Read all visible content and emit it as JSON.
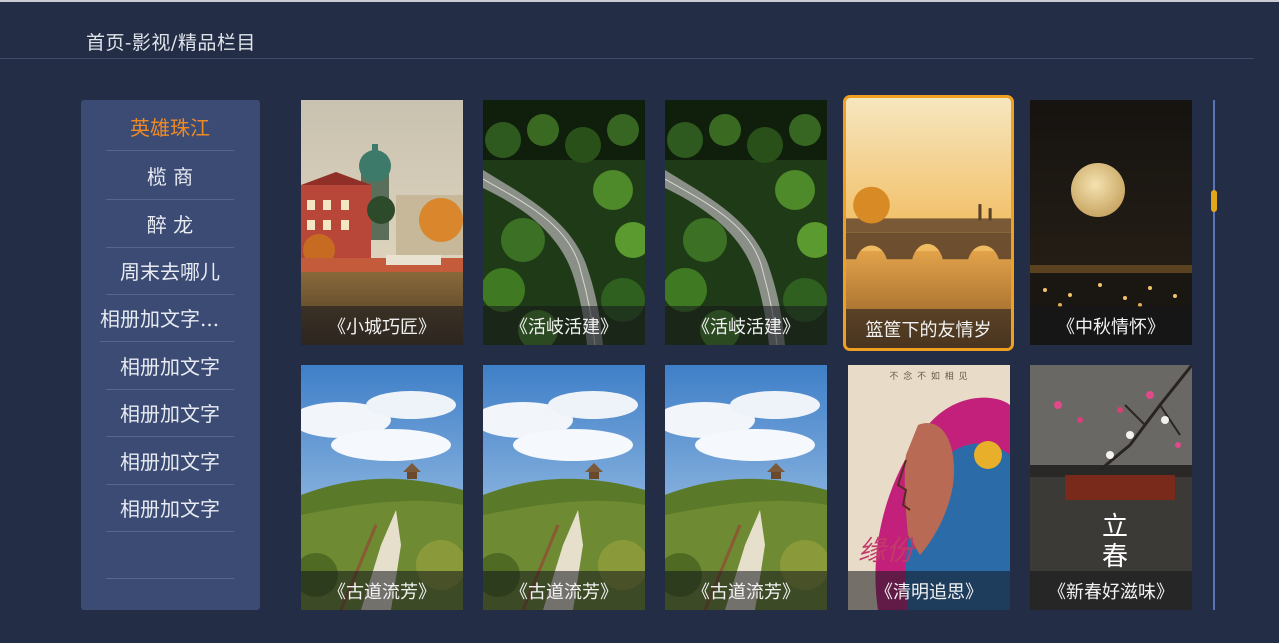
{
  "breadcrumb": "首页-影视/精品栏目",
  "sidebar": {
    "items": [
      {
        "label": "英雄珠江",
        "active": true
      },
      {
        "label": "榄 商"
      },
      {
        "label": "醉 龙"
      },
      {
        "label": "周末去哪儿"
      },
      {
        "label": "相册加文字..."
      },
      {
        "label": "相册加文字"
      },
      {
        "label": "相册加文字"
      },
      {
        "label": "相册加文字"
      },
      {
        "label": "相册加文字"
      }
    ]
  },
  "grid": {
    "cards": [
      {
        "title": "《小城巧匠》",
        "scene": "town"
      },
      {
        "title": "《活岐活建》",
        "scene": "forest-road"
      },
      {
        "title": "《活岐活建》",
        "scene": "forest-road"
      },
      {
        "title": "篮筐下的友情岁",
        "scene": "bridge",
        "focused": true
      },
      {
        "title": "《中秋情怀》",
        "scene": "moon"
      },
      {
        "title": "《古道流芳》",
        "scene": "trail"
      },
      {
        "title": "《古道流芳》",
        "scene": "trail"
      },
      {
        "title": "《古道流芳》",
        "scene": "trail"
      },
      {
        "title": "《清明追思》",
        "scene": "poster",
        "poster_top": "不 念 不 如 相 见",
        "poster_big": "缘份"
      },
      {
        "title": "《新春好滋味》",
        "scene": "spring",
        "poster_big_1": "立",
        "poster_big_2": "春"
      }
    ]
  },
  "colors": {
    "background": "#232d45",
    "sidebar": "#3b4b74",
    "accent": "#f08a24",
    "focus": "#f0a020",
    "scrollbar": "#5a74b8"
  }
}
